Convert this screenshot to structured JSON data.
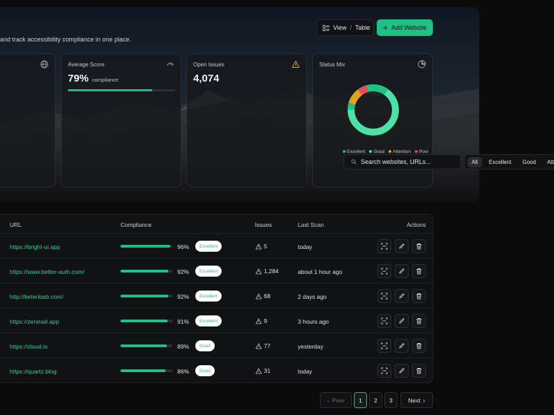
{
  "header": {
    "subtitle": "and track accessibility compliance in one place.",
    "view_label": "View",
    "view_sep": "/",
    "view_mode": "Table",
    "add_label": "Add Website"
  },
  "cards": {
    "websites": {
      "icon": "globe-icon"
    },
    "average_score": {
      "label": "Average Score",
      "value": "79%",
      "suffix": "compliance",
      "progress_pct": 79,
      "icon": "gauge-icon"
    },
    "open_issues": {
      "label": "Open Issues",
      "value": "4,074",
      "icon": "warning-icon"
    },
    "status_mix": {
      "label": "Status Mix",
      "icon": "pie-chart-icon",
      "legend": [
        "Excellent",
        "Good",
        "Attention",
        "Poor"
      ]
    }
  },
  "colors": {
    "accent": "#1fbf85",
    "excellent": "#1fbf85",
    "good": "#4fe0a8",
    "attention": "#e6a21b",
    "poor": "#e24d5c",
    "warning": "#e6a21b"
  },
  "search": {
    "placeholder": "Search websites, URLs..."
  },
  "filters": [
    "All",
    "Excellent",
    "Good",
    "Attenti"
  ],
  "table": {
    "headers": {
      "url": "URL",
      "compliance": "Compliance",
      "issues": "Issues",
      "last_scan": "Last Scan",
      "actions": "Actions"
    },
    "rows": [
      {
        "url": "https://bright-ui.app",
        "compliance": 96,
        "pct": "96%",
        "status": "Excellent",
        "issues": "5",
        "last_scan": "today"
      },
      {
        "url": "https://www.better-auth.com/",
        "compliance": 92,
        "pct": "92%",
        "status": "Excellent",
        "issues": "1,284",
        "last_scan": "about 1 hour ago"
      },
      {
        "url": "http://betenbab.com/",
        "compliance": 92,
        "pct": "92%",
        "status": "Excellent",
        "issues": "68",
        "last_scan": "2 days ago"
      },
      {
        "url": "https://zenmail.app",
        "compliance": 91,
        "pct": "91%",
        "status": "Excellent",
        "issues": "9",
        "last_scan": "3 hours ago"
      },
      {
        "url": "https://cloud.io",
        "compliance": 89,
        "pct": "89%",
        "status": "Good",
        "issues": "77",
        "last_scan": "yesterday"
      },
      {
        "url": "https://quartz.blog",
        "compliance": 86,
        "pct": "86%",
        "status": "Good",
        "issues": "31",
        "last_scan": "today"
      }
    ]
  },
  "pagination": {
    "prev": "Prev",
    "pages": [
      "1",
      "2",
      "3"
    ],
    "current": "1",
    "next": "Next"
  }
}
